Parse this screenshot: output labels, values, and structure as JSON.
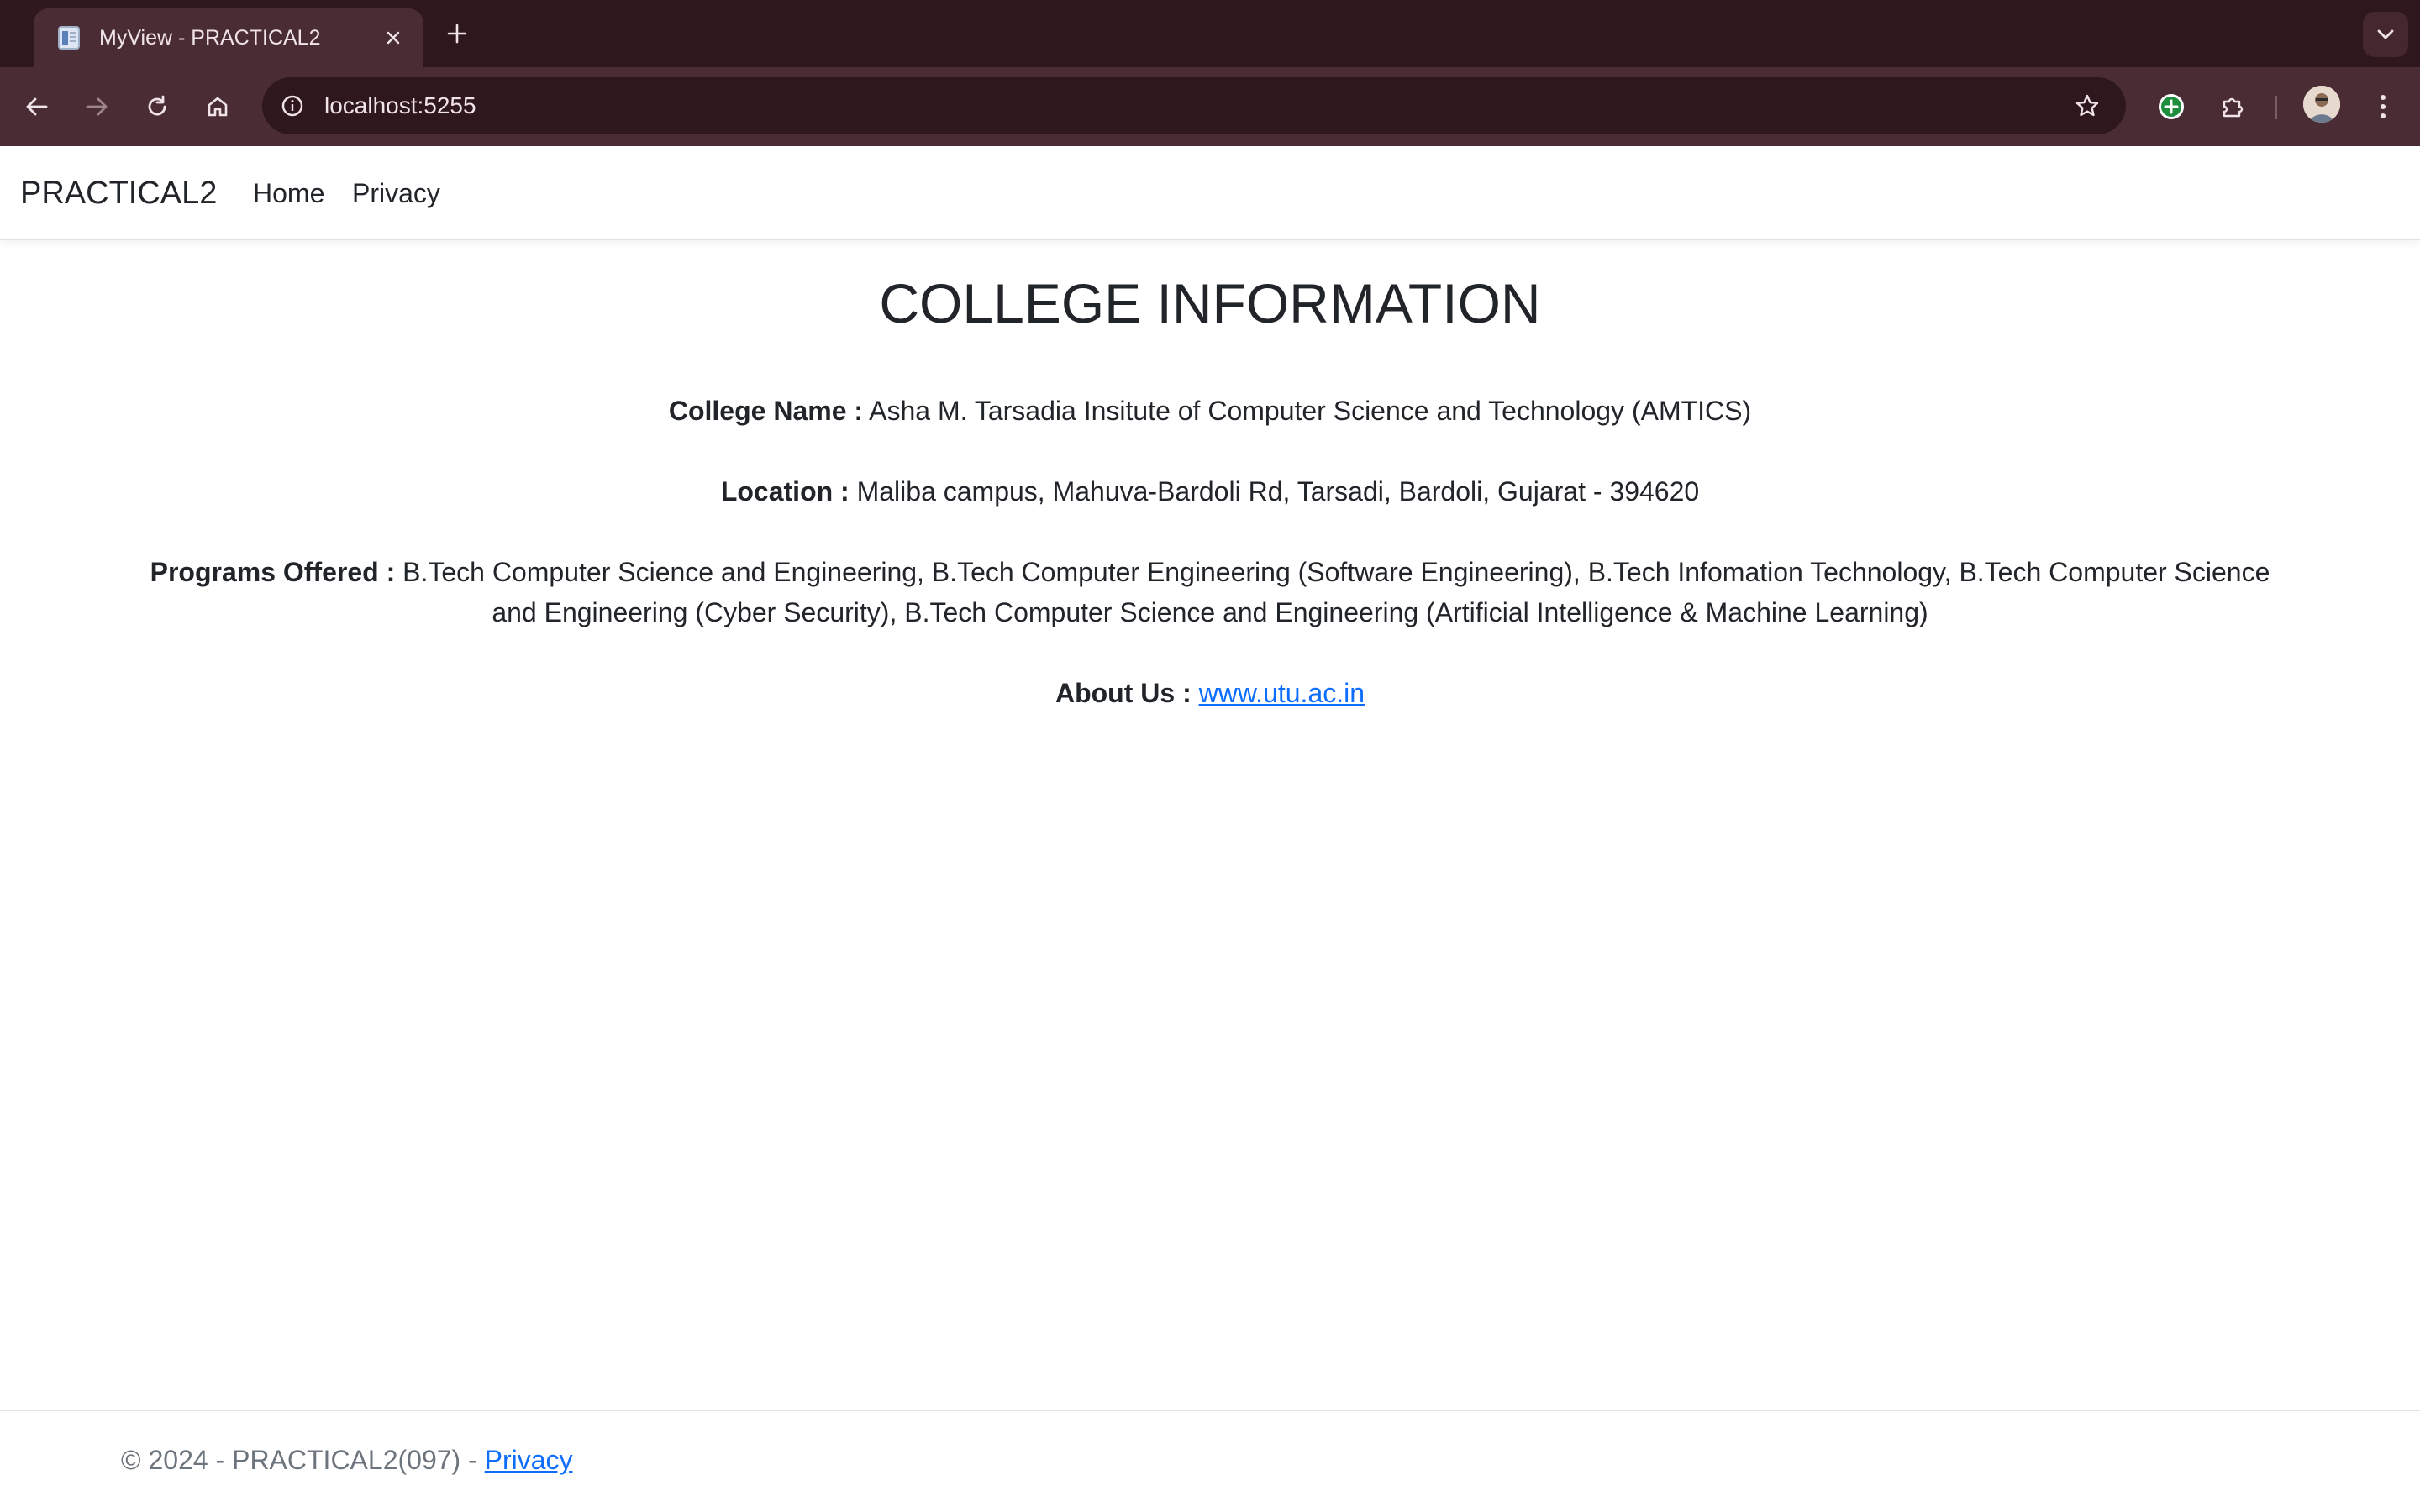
{
  "browser": {
    "tab_title": "MyView - PRACTICAL2",
    "url": "localhost:5255",
    "icons": {
      "favicon": "document-icon",
      "tab_close": "close-icon",
      "new_tab": "plus-icon",
      "tab_search": "chevron-down-icon",
      "back": "arrow-left-icon",
      "forward": "arrow-right-icon",
      "reload": "reload-icon",
      "home": "home-icon",
      "site_info": "info-icon",
      "bookmark": "star-icon",
      "extension_add": "plus-circle-icon",
      "extensions": "puzzle-icon",
      "profile": "avatar",
      "menu": "kebab-menu-icon"
    },
    "colors": {
      "tabstrip": "#2e181e",
      "toolbar": "#4a2d34"
    }
  },
  "navbar": {
    "brand": "PRACTICAL2",
    "links": [
      "Home",
      "Privacy"
    ]
  },
  "main": {
    "heading": "COLLEGE INFORMATION",
    "college_name": {
      "label": "College Name :",
      "value": "Asha M. Tarsadia Insitute of Computer Science and Technology (AMTICS)"
    },
    "location": {
      "label": "Location :",
      "value": "Maliba campus, Mahuva-Bardoli Rd, Tarsadi, Bardoli, Gujarat - 394620"
    },
    "programs": {
      "label": "Programs Offered :",
      "line1": "B.Tech Computer Science and Engineering, B.Tech Computer Engineering (Software Engineering), B.Tech Infomation Technology, B.Tech Computer Science",
      "line2": "and Engineering (Cyber Security), B.Tech Computer Science and Engineering (Artificial Intelligence & Machine Learning)"
    },
    "about": {
      "label": "About Us :",
      "link": "www.utu.ac.in"
    }
  },
  "footer": {
    "text": "© 2024 - PRACTICAL2(097) - ",
    "privacy_link": "Privacy"
  },
  "colors": {
    "link": "#0d6efd",
    "text": "#212529",
    "footer_text": "#6c757d"
  }
}
